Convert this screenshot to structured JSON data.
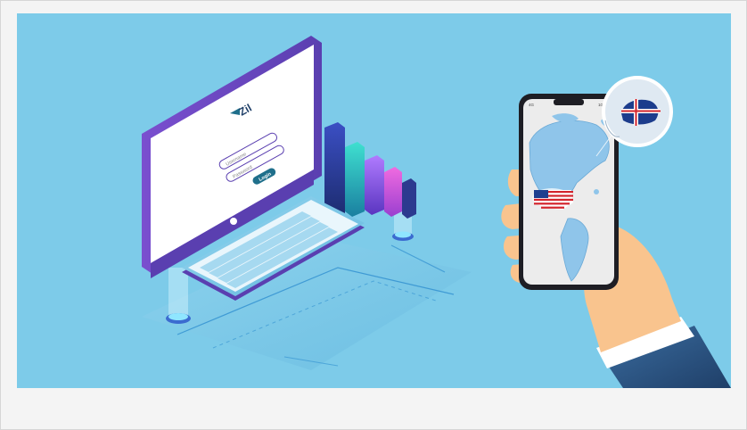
{
  "illustration": {
    "brand_text": "Zil",
    "username_placeholder": "Username",
    "password_placeholder": "Password",
    "login_label": "Login",
    "phone_status_left": "4G",
    "phone_status_right": "100",
    "colors": {
      "background": "#7dcbe9",
      "monitor_frame": "#6f4fbf",
      "screen": "#ffffff",
      "login_button": "#1f6f8b",
      "keyboard": "#e9f6fc",
      "skin": "#f9c48e",
      "sleeve": "#2f5b87",
      "map_land": "#8fc5ea"
    }
  }
}
